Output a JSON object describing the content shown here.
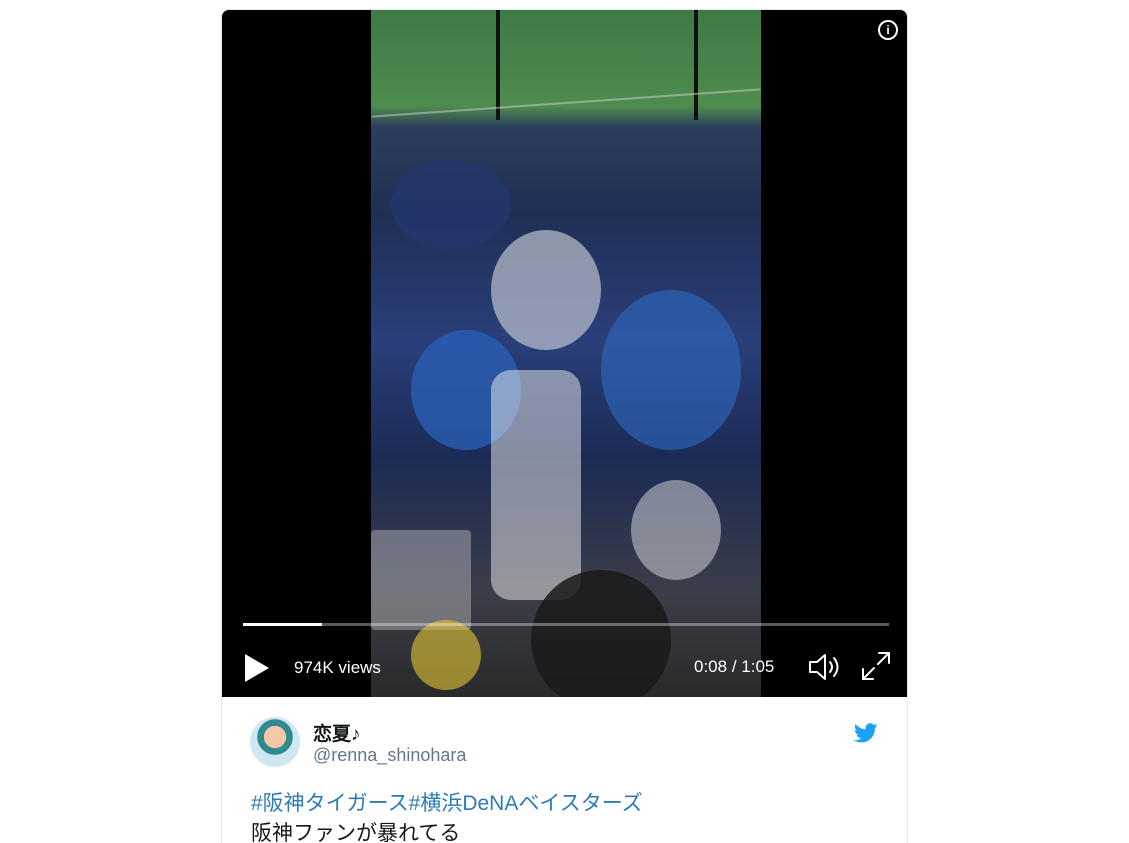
{
  "video": {
    "views": "974K views",
    "current_time": "0:08",
    "time_separator": " / ",
    "duration": "1:05",
    "progress": 0.123,
    "info_label": "i"
  },
  "author": {
    "display_name": "恋夏♪",
    "handle": "@renna_shinohara"
  },
  "tweet": {
    "hashtags": [
      "#阪神タイガース",
      "#横浜DeNAベイスターズ"
    ],
    "text": "阪神ファンが暴れてる"
  },
  "colors": {
    "link": "#2b7bb9",
    "twitter_blue": "#1da1f2",
    "player_bg": "#000000"
  },
  "icons": [
    "info-icon",
    "play-icon",
    "volume-icon",
    "fullscreen-icon",
    "twitter-bird-icon"
  ]
}
